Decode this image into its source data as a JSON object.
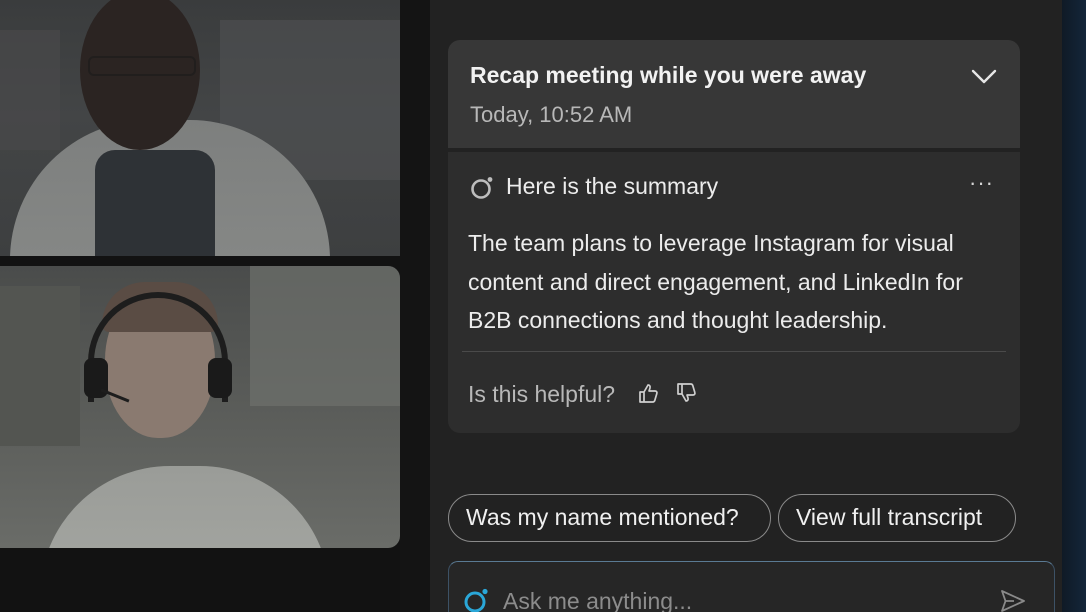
{
  "recap": {
    "title": "Recap meeting while you were away",
    "timestamp": "Today, 10:52 AM",
    "toggle_icon": "chevron-down-icon"
  },
  "summary": {
    "heading": "Here is the summary",
    "body": "The team plans to leverage Instagram for visual content and direct engagement, and LinkedIn for B2B connections and thought leadership.",
    "more_label": "···",
    "feedback_label": "Is this helpful?",
    "icons": [
      "copilot-icon",
      "more-options-icon",
      "thumbs-up-icon",
      "thumbs-down-icon"
    ]
  },
  "suggestions": [
    {
      "label": "Was my name mentioned?"
    },
    {
      "label": "View full transcript"
    }
  ],
  "ask": {
    "placeholder": "Ask me anything...",
    "icons": [
      "copilot-icon",
      "send-icon"
    ]
  },
  "colors": {
    "panel_bg": "#222222",
    "card_header_bg": "#373737",
    "card_body_bg": "#2d2d2d",
    "accent_blue": "#2aa7d8",
    "text_primary": "#f2f2f2",
    "text_secondary": "#b8b8b8"
  }
}
